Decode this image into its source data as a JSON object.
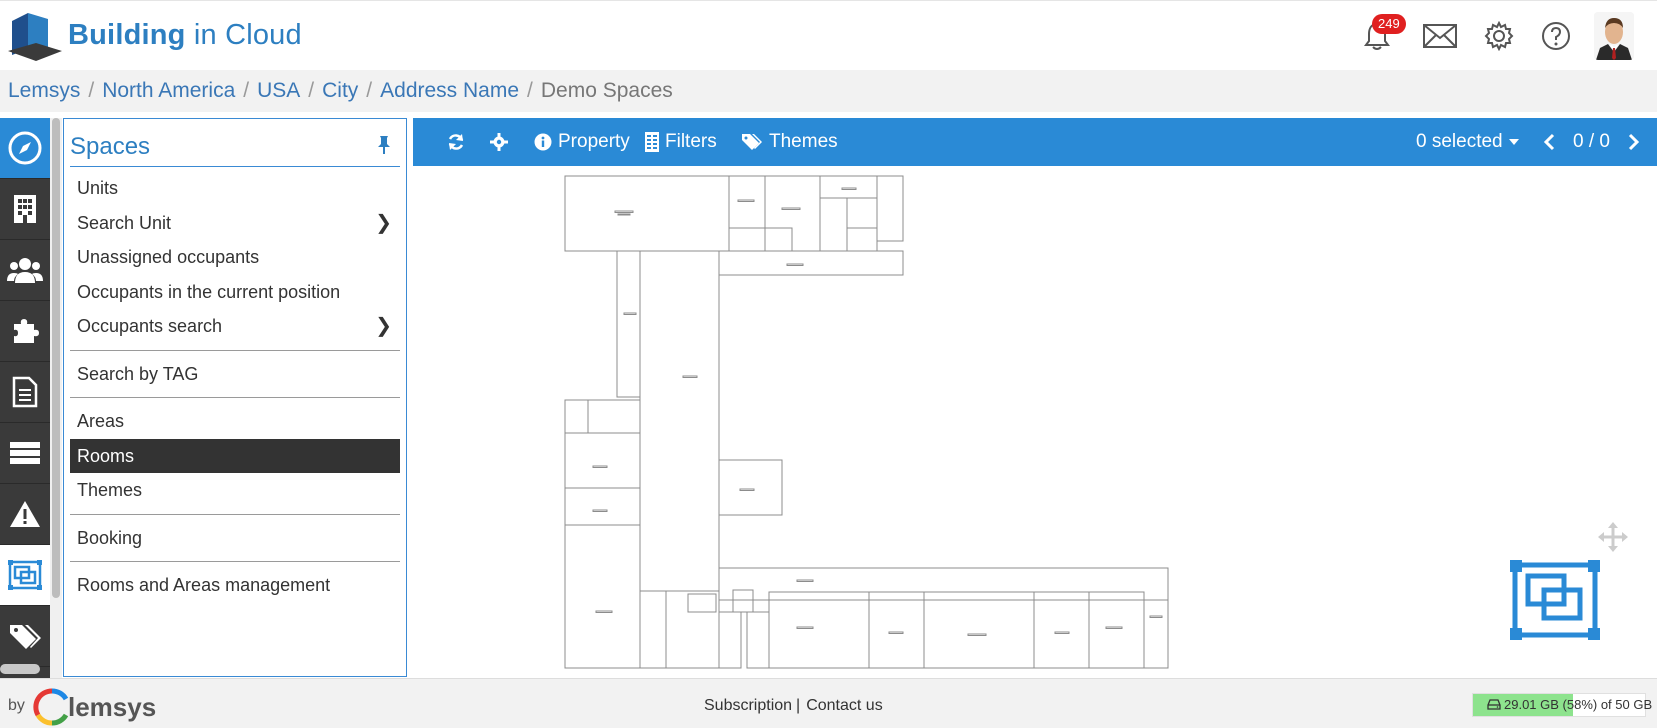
{
  "app": {
    "brand_bold": "Building",
    "brand_rest": " in Cloud",
    "notification_count": "249"
  },
  "breadcrumb": [
    {
      "label": "Lemsys"
    },
    {
      "label": "North America"
    },
    {
      "label": "USA"
    },
    {
      "label": "City"
    },
    {
      "label": "Address Name"
    },
    {
      "label": "Demo Spaces"
    }
  ],
  "panel": {
    "title": "Spaces",
    "items": [
      {
        "label": "Units"
      },
      {
        "label": "Search Unit"
      },
      {
        "label": "Unassigned occupants"
      },
      {
        "label": "Occupants in the current position"
      },
      {
        "label": "Occupants search"
      },
      {
        "label": "Search by TAG"
      },
      {
        "label": "Areas"
      },
      {
        "label": "Rooms"
      },
      {
        "label": "Themes"
      },
      {
        "label": "Booking"
      },
      {
        "label": "Rooms and Areas management"
      }
    ]
  },
  "toolbar": {
    "property": "Property",
    "filters": "Filters",
    "themes": "Themes",
    "selected": "0 selected",
    "pager": "0 / 0"
  },
  "footer": {
    "by": "by",
    "brand": "lemsys",
    "subscription": "Subscription",
    "pipe": "|",
    "contact": "Contact us",
    "storage_text": "29.01 GB (58%) of 50 GB",
    "storage_fraction": 0.58
  },
  "colors": {
    "accent": "#2a8ad6",
    "brand": "#2d7fc1",
    "rail": "#3a3a3a",
    "badge": "#e02020",
    "storage": "#8de38d"
  }
}
